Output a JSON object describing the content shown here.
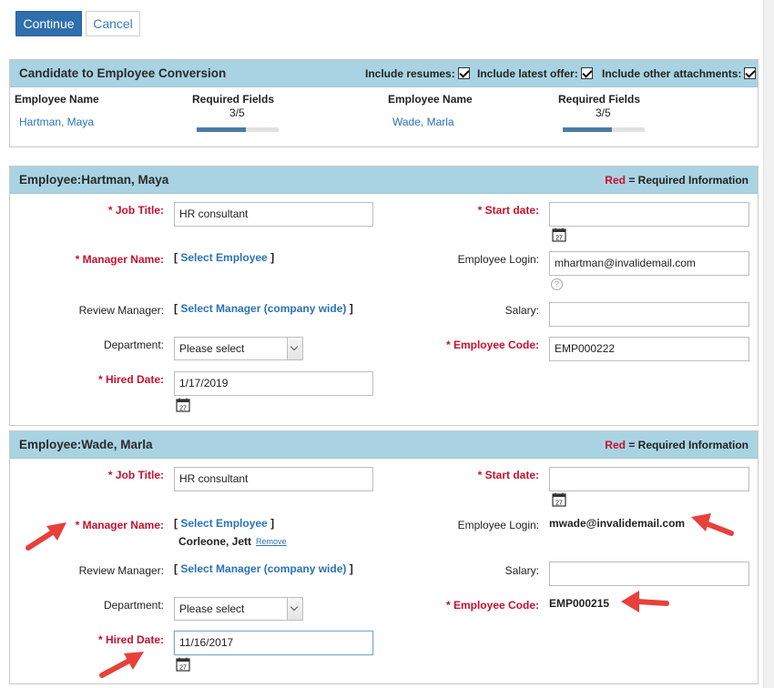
{
  "actions": {
    "continue_label": "Continue",
    "cancel_label": "Cancel"
  },
  "conversion": {
    "title": "Candidate to Employee Conversion",
    "options": [
      {
        "label": "Include resumes:",
        "checked": true
      },
      {
        "label": "Include latest offer:",
        "checked": true
      },
      {
        "label": "Include other attachments:",
        "checked": true
      }
    ],
    "col_employee": "Employee Name",
    "col_required": "Required Fields",
    "candidates": [
      {
        "name": "Hartman, Maya",
        "required": "3/5",
        "progress": 0.6
      },
      {
        "name": "Wade, Marla",
        "required": "3/5",
        "progress": 0.6
      }
    ]
  },
  "legend": {
    "red": "Red",
    "text": "= Required Information"
  },
  "forms": [
    {
      "title": "Employee:Hartman, Maya",
      "job_title_label": "* Job Title:",
      "job_title": "HR consultant",
      "manager_label": "* Manager Name:",
      "select_employee": "Select Employee",
      "manager_selected": "",
      "remove": "",
      "review_label": "Review Manager:",
      "select_manager": "Select Manager (company wide)",
      "department_label": "Department:",
      "department": "Please select",
      "hired_label": "* Hired Date:",
      "hired": "1/17/2019",
      "start_label": "* Start date:",
      "start": "",
      "login_label": "Employee Login:",
      "login": "mhartman@invalidemail.com",
      "salary_label": "Salary:",
      "salary": "",
      "code_label": "* Employee Code:",
      "code": "EMP000222",
      "cal_day": "27",
      "help": "?"
    },
    {
      "title": "Employee:Wade, Marla",
      "job_title_label": "* Job Title:",
      "job_title": "HR consultant",
      "manager_label": "* Manager Name:",
      "select_employee": "Select Employee",
      "manager_selected": "Corleone, Jett",
      "remove": "Remove",
      "review_label": "Review Manager:",
      "select_manager": "Select Manager (company wide)",
      "department_label": "Department:",
      "department": "Please select",
      "hired_label": "* Hired Date:",
      "hired": "11/16/2017",
      "start_label": "* Start date:",
      "start": "",
      "login_label": "Employee Login:",
      "login": "mwade@invalidemail.com",
      "salary_label": "Salary:",
      "salary": "",
      "code_label": "* Employee Code:",
      "code": "EMP000215",
      "cal_day": "27"
    }
  ],
  "colors": {
    "header_bg": "#a9d3e2",
    "primary": "#2f6fad",
    "required": "#c8102e",
    "annotation_arrow": "#e8403a"
  },
  "icons": [
    "calendar-icon",
    "help-icon",
    "checkbox-checked-icon",
    "chevron-down-icon",
    "annotation-arrow-icon"
  ]
}
